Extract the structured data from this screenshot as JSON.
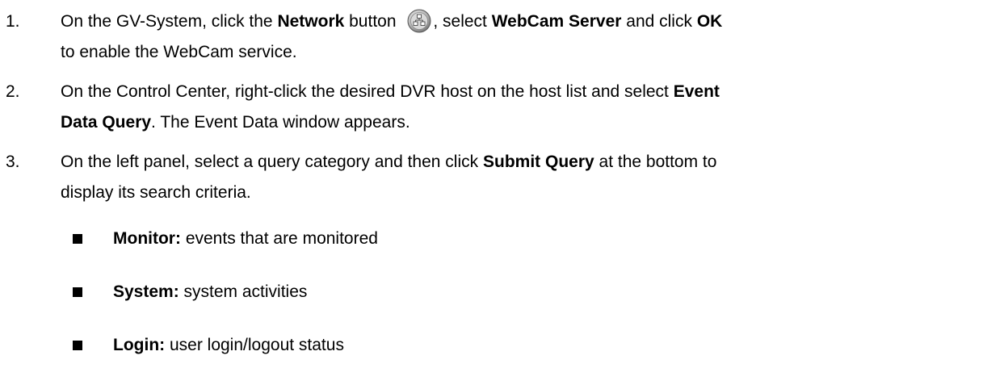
{
  "steps": [
    {
      "number": "1.",
      "line1": {
        "t1": "On the GV-System, click the ",
        "b1": "Network",
        "t2": " button ",
        "t3": ", select ",
        "b2": "WebCam Server",
        "t4": " and click ",
        "b3": "OK"
      },
      "line2": "to enable the WebCam service.",
      "icon": "network-icon"
    },
    {
      "number": "2.",
      "line1": {
        "t1": "On the Control Center, right-click the desired DVR host on the host list and select ",
        "b1": "Event"
      },
      "line2": {
        "b1": "Data Query",
        "t1": ". The Event Data window appears."
      }
    },
    {
      "number": "3.",
      "line1": {
        "t1": "On the left panel, select a query category and then click ",
        "b1": "Submit Query",
        "t2": " at the bottom to"
      },
      "line2": "display its search criteria."
    }
  ],
  "categories": [
    {
      "term": "Monitor:",
      "desc": " events that are monitored"
    },
    {
      "term": "System:",
      "desc": " system activities"
    },
    {
      "term": "Login:",
      "desc": " user login/logout status"
    }
  ]
}
